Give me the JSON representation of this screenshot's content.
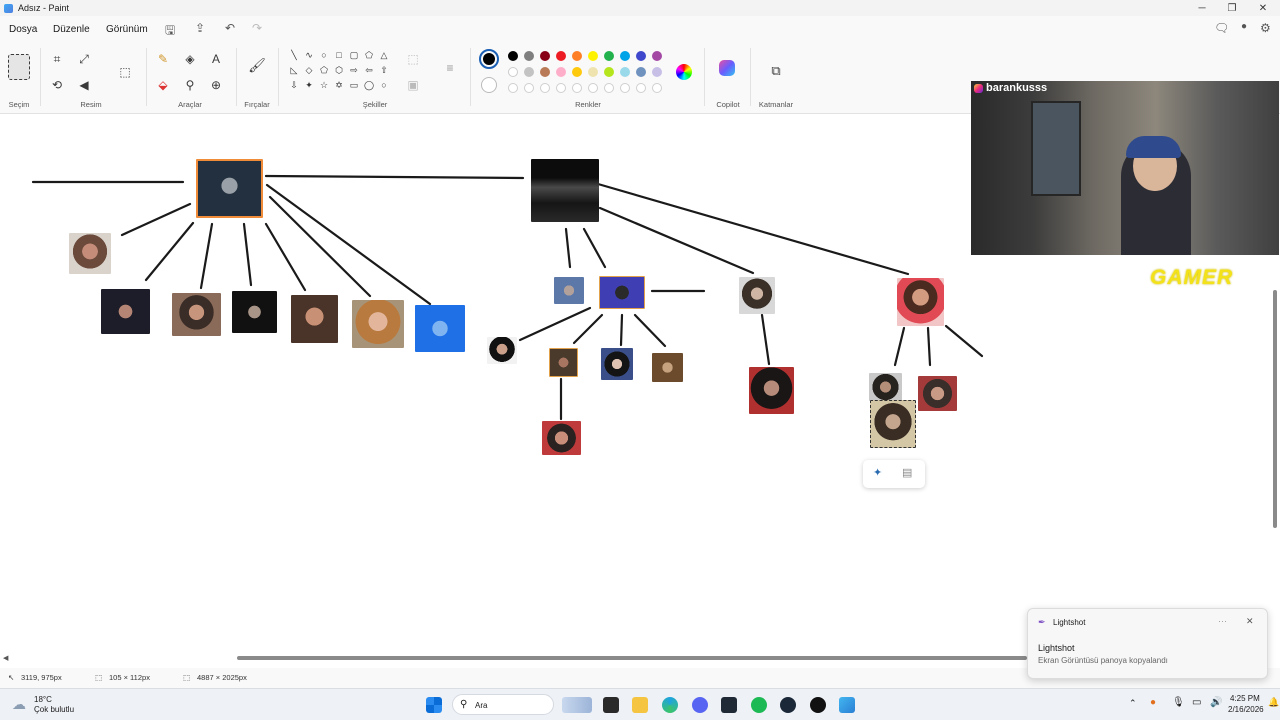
{
  "window": {
    "title": "Adsız - Paint"
  },
  "menu": {
    "file": "Dosya",
    "edit": "Düzenle",
    "view": "Görünüm"
  },
  "ribbon": {
    "groups": {
      "selection": "Seçim",
      "image": "Resim",
      "tools": "Araçlar",
      "brushes": "Fırçalar",
      "shapes": "Şekiller",
      "colors": "Renkler",
      "copilot": "Copilot",
      "layers": "Katmanlar"
    },
    "palette_row1": [
      "#000000",
      "#7f7f7f",
      "#880015",
      "#ed1c24",
      "#ff7f27",
      "#fff200",
      "#22b14c",
      "#00a2e8",
      "#3f48cc",
      "#a349a4"
    ],
    "palette_row2": [
      "#ffffff",
      "#c3c3c3",
      "#b97a57",
      "#ffaec9",
      "#ffc90e",
      "#efe4b0",
      "#b5e61d",
      "#99d9ea",
      "#7092be",
      "#c8bfe7"
    ],
    "active_color": "#000000"
  },
  "overlay": {
    "streamer_name": "barankusss",
    "brand_text": "GAMER"
  },
  "status": {
    "cursor_position": "3119, 975px",
    "selection_size": "105 × 112px",
    "canvas_size": "4887 × 2025px"
  },
  "toast": {
    "app": "Lightshot",
    "title": "Lightshot",
    "message": "Ekran Görüntüsü panoya kopyalandı"
  },
  "taskbar": {
    "weather_temp": "18°C",
    "weather_desc": "Çok bulutlu",
    "search_placeholder": "Ara",
    "time": "4:25 PM",
    "date": "2/16/2026"
  }
}
